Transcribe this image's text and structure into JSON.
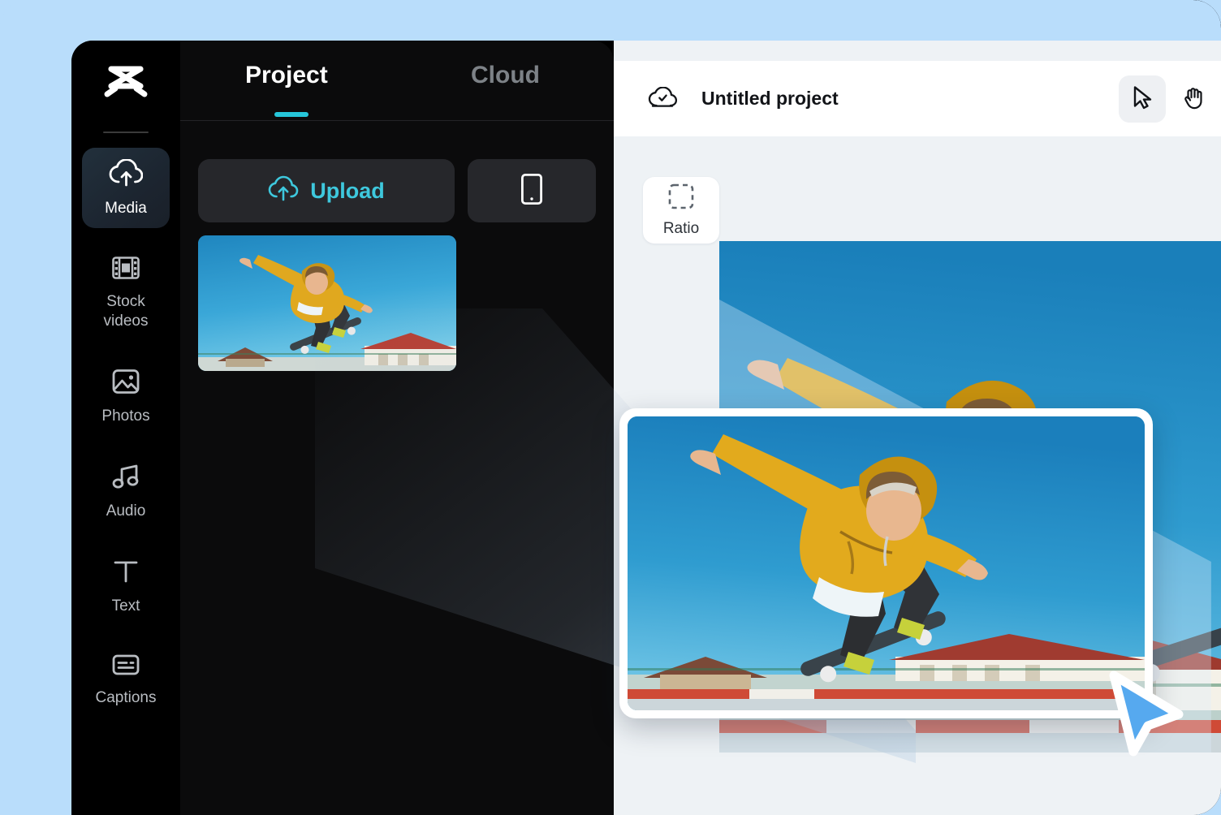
{
  "theme": {
    "page_background": "#b9ddfb",
    "window_background": "#000000",
    "panel_background": "#0b0b0c",
    "accent_cyan": "#26c6da",
    "upload_text": "#3ec8dd",
    "editor_background": "#eef2f5",
    "cursor_blue": "#56a9ef"
  },
  "rail": {
    "logo_icon": "capcut-logo-icon",
    "items": [
      {
        "id": "media",
        "label": "Media",
        "icon": "cloud-upload-icon",
        "active": true
      },
      {
        "id": "stock-videos",
        "label": "Stock\nvideos",
        "label_line1": "Stock",
        "label_line2": "videos",
        "icon": "film-strip-icon",
        "active": false
      },
      {
        "id": "photos",
        "label": "Photos",
        "icon": "image-icon",
        "active": false
      },
      {
        "id": "audio",
        "label": "Audio",
        "icon": "music-note-icon",
        "active": false
      },
      {
        "id": "text",
        "label": "Text",
        "icon": "text-t-icon",
        "active": false
      },
      {
        "id": "captions",
        "label": "Captions",
        "icon": "captions-icon",
        "active": false
      }
    ]
  },
  "media_panel": {
    "tabs": [
      {
        "id": "project",
        "label": "Project",
        "active": true
      },
      {
        "id": "cloud",
        "label": "Cloud",
        "active": false
      }
    ],
    "upload_button": {
      "label": "Upload",
      "icon": "cloud-upload-icon"
    },
    "phone_button": {
      "label": "",
      "icon": "mobile-phone-icon"
    },
    "media_items": [
      {
        "id": "clip-1",
        "alt": "Skateboarder mid-air jump against blue sky"
      }
    ]
  },
  "editor": {
    "topbar": {
      "cloud_icon": "cloud-check-icon",
      "project_title": "Untitled project",
      "tools": [
        {
          "id": "select",
          "icon": "cursor-arrow-icon",
          "selected": true
        },
        {
          "id": "hand",
          "icon": "hand-icon",
          "selected": false
        }
      ]
    },
    "ratio_button": {
      "label": "Ratio",
      "icon": "crop-frame-icon"
    },
    "canvas": {
      "alt": "Skateboarder mid-air jump against blue sky"
    }
  },
  "drag": {
    "card_alt": "Skateboarder mid-air jump against blue sky",
    "cursor_icon": "drag-cursor-icon"
  }
}
